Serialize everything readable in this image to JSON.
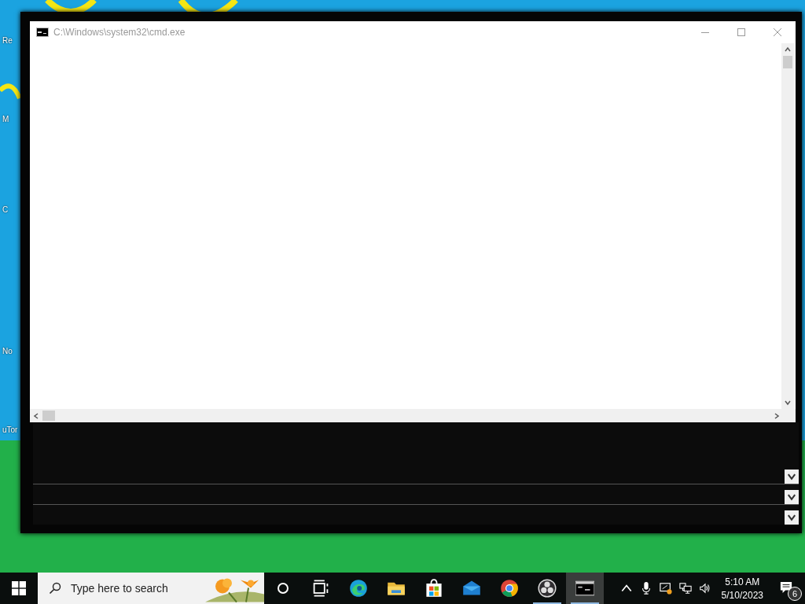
{
  "desktop": {
    "icons": [
      {
        "label": "Re"
      },
      {
        "label": "M"
      },
      {
        "label": "C"
      },
      {
        "label": "No"
      },
      {
        "label": "uTor"
      }
    ]
  },
  "window": {
    "title": "C:\\Windows\\system32\\cmd.exe"
  },
  "taskbar": {
    "search": {
      "placeholder": "Type here to search"
    },
    "apps": [
      {
        "kind": "taskview",
        "running": false,
        "selected": false
      },
      {
        "kind": "edge",
        "running": false,
        "selected": false
      },
      {
        "kind": "explorer",
        "running": false,
        "selected": false
      },
      {
        "kind": "store",
        "running": false,
        "selected": false
      },
      {
        "kind": "mail",
        "running": false,
        "selected": false
      },
      {
        "kind": "chrome",
        "running": false,
        "selected": false
      },
      {
        "kind": "obs",
        "running": true,
        "selected": false
      },
      {
        "kind": "cmd",
        "running": true,
        "selected": true
      }
    ],
    "clock": {
      "time": "5:10 AM",
      "date": "5/10/2023"
    },
    "notifications": {
      "count": "6"
    }
  }
}
